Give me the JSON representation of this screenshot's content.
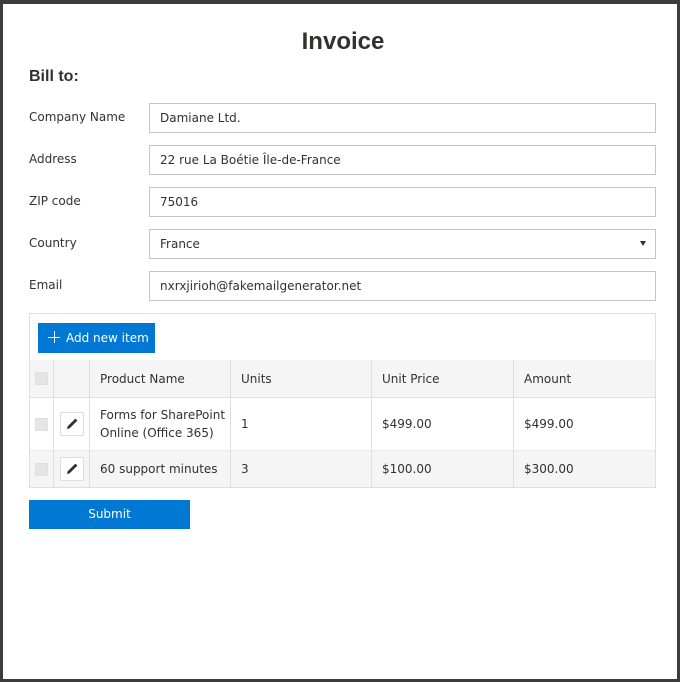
{
  "page": {
    "title": "Invoice"
  },
  "bill_to": {
    "heading": "Bill to:",
    "fields": {
      "company": {
        "label": "Company Name",
        "value": "Damiane Ltd."
      },
      "address": {
        "label": "Address",
        "value": "22 rue La Boétie Île-de-France"
      },
      "zip": {
        "label": "ZIP code",
        "value": "75016"
      },
      "country": {
        "label": "Country",
        "value": "France"
      },
      "email": {
        "label": "Email",
        "value": "nxrxjirioh@fakemailgenerator.net"
      }
    }
  },
  "grid": {
    "add_button_label": "Add new item",
    "columns": [
      "Product Name",
      "Units",
      "Unit Price",
      "Amount"
    ],
    "rows": [
      {
        "product": "Forms for SharePoint Online (Office 365)",
        "units": "1",
        "unit_price": "$499.00",
        "amount": "$499.00"
      },
      {
        "product": "60 support minutes",
        "units": "3",
        "unit_price": "$100.00",
        "amount": "$300.00"
      }
    ]
  },
  "submit_label": "Submit",
  "icons": {
    "add": "plus-icon",
    "edit": "pencil-icon",
    "dropdown": "chevron-down-icon"
  },
  "colors": {
    "accent": "#0078d4",
    "frame": "#3c3c3c",
    "header_bg": "#f5f5f5"
  }
}
